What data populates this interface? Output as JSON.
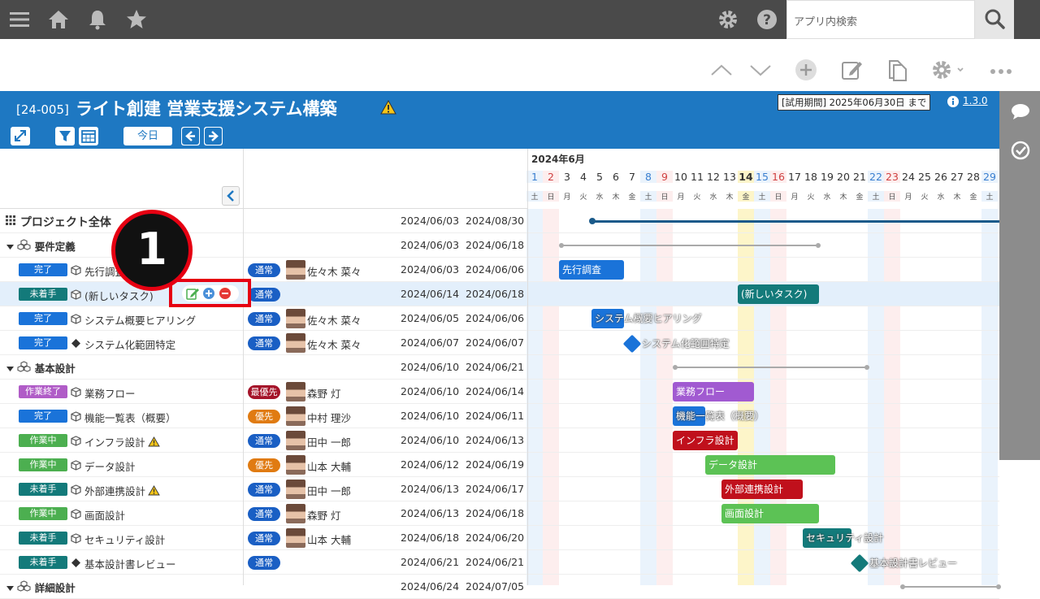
{
  "topbar": {
    "search_placeholder": "アプリ内検索"
  },
  "project": {
    "code": "[24-005]",
    "title": "ライト創建 営業支援システム構築",
    "trial": "[試用期間] 2025年06月30日 まで",
    "version": "1.3.0",
    "today_label": "今日"
  },
  "gantt": {
    "month_label": "2024年6月",
    "days": [
      "1",
      "2",
      "3",
      "4",
      "5",
      "6",
      "7",
      "8",
      "9",
      "10",
      "11",
      "12",
      "13",
      "14",
      "15",
      "16",
      "17",
      "18",
      "19",
      "20",
      "21",
      "22",
      "23",
      "24",
      "25",
      "26",
      "27",
      "28",
      "29"
    ],
    "weekdays": [
      "土",
      "日",
      "月",
      "火",
      "水",
      "木",
      "金",
      "土",
      "日",
      "月",
      "火",
      "水",
      "木",
      "金",
      "土",
      "日",
      "月",
      "火",
      "水",
      "木",
      "金",
      "土",
      "日",
      "月",
      "火",
      "水",
      "木",
      "金",
      "土"
    ],
    "today_index": 13
  },
  "callout": {
    "number": "1"
  },
  "rows": [
    {
      "type": "project",
      "name": "プロジェクト全体",
      "start": "2024/06/03",
      "end": "2024/08/30"
    },
    {
      "type": "group",
      "name": "要件定義",
      "start": "2024/06/03",
      "end": "2024/06/18"
    },
    {
      "type": "task",
      "status": "完了",
      "status_color": "#1a73d9",
      "name": "先行調査",
      "prio": "通常",
      "prio_color": "#1a5fc4",
      "person": "佐々木 菜々",
      "start": "2024/06/03",
      "end": "2024/06/06",
      "bar_label": "先行調査"
    },
    {
      "type": "task",
      "status": "未着手",
      "status_color": "#137a7a",
      "name": "(新しいタスク)",
      "prio": "通常",
      "prio_color": "#1a5fc4",
      "person": "",
      "start": "2024/06/14",
      "end": "2024/06/18",
      "bar_label": "(新しいタスク)"
    },
    {
      "type": "task",
      "status": "完了",
      "status_color": "#1a73d9",
      "name": "システム概要ヒアリング",
      "prio": "通常",
      "prio_color": "#1a5fc4",
      "person": "佐々木 菜々",
      "start": "2024/06/05",
      "end": "2024/06/06",
      "bar_label": "システム概要ヒアリング"
    },
    {
      "type": "milestone",
      "status": "完了",
      "status_color": "#1a73d9",
      "name": "システム化範囲特定",
      "prio": "通常",
      "prio_color": "#1a5fc4",
      "person": "佐々木 菜々",
      "start": "2024/06/07",
      "end": "2024/06/07",
      "bar_label": "システム化範囲特定"
    },
    {
      "type": "group",
      "name": "基本設計",
      "start": "2024/06/10",
      "end": "2024/06/21"
    },
    {
      "type": "task",
      "status": "作業終了",
      "status_color": "#b05cc7",
      "name": "業務フロー",
      "prio": "最優先",
      "prio_color": "#a5142a",
      "person": "森野 灯",
      "start": "2024/06/10",
      "end": "2024/06/14",
      "bar_label": "業務フロー"
    },
    {
      "type": "task",
      "status": "完了",
      "status_color": "#1a73d9",
      "name": "機能一覧表（概要）",
      "prio": "優先",
      "prio_color": "#e07b12",
      "person": "中村 理沙",
      "start": "2024/06/10",
      "end": "2024/06/11",
      "bar_label": "機能一覧表（概要）"
    },
    {
      "type": "task",
      "status": "作業中",
      "status_color": "#4caf50",
      "name": "インフラ設計",
      "prio": "通常",
      "prio_color": "#1a5fc4",
      "person": "田中 一郎",
      "start": "2024/06/10",
      "end": "2024/06/13",
      "bar_label": "インフラ設計"
    },
    {
      "type": "task",
      "status": "作業中",
      "status_color": "#4caf50",
      "name": "データ設計",
      "prio": "優先",
      "prio_color": "#e07b12",
      "person": "山本 大輔",
      "start": "2024/06/12",
      "end": "2024/06/19",
      "bar_label": "データ設計"
    },
    {
      "type": "task",
      "status": "未着手",
      "status_color": "#137a7a",
      "name": "外部連携設計",
      "prio": "通常",
      "prio_color": "#1a5fc4",
      "person": "田中 一郎",
      "start": "2024/06/13",
      "end": "2024/06/17",
      "bar_label": "外部連携設計"
    },
    {
      "type": "task",
      "status": "作業中",
      "status_color": "#4caf50",
      "name": "画面設計",
      "prio": "通常",
      "prio_color": "#1a5fc4",
      "person": "森野 灯",
      "start": "2024/06/13",
      "end": "2024/06/18",
      "bar_label": "画面設計"
    },
    {
      "type": "task",
      "status": "未着手",
      "status_color": "#137a7a",
      "name": "セキュリティ設計",
      "prio": "通常",
      "prio_color": "#1a5fc4",
      "person": "山本 大輔",
      "start": "2024/06/18",
      "end": "2024/06/20",
      "bar_label": "セキュリティ設計"
    },
    {
      "type": "milestone",
      "status": "未着手",
      "status_color": "#137a7a",
      "name": "基本設計書レビュー",
      "prio": "通常",
      "prio_color": "#1a5fc4",
      "person": "",
      "start": "2024/06/21",
      "end": "2024/06/21",
      "bar_label": "基本設計書レビュー"
    },
    {
      "type": "group",
      "name": "詳細設計",
      "start": "2024/06/24",
      "end": "2024/07/05"
    }
  ],
  "colors": {
    "topbar": "#4a4a4a",
    "header": "#1e78c2",
    "bar_red": "#c0101c",
    "bar_purple": "#a15ad1",
    "bar_green": "#5cc255",
    "bar_teal": "#137a7a",
    "bar_blue": "#1a73d9"
  }
}
